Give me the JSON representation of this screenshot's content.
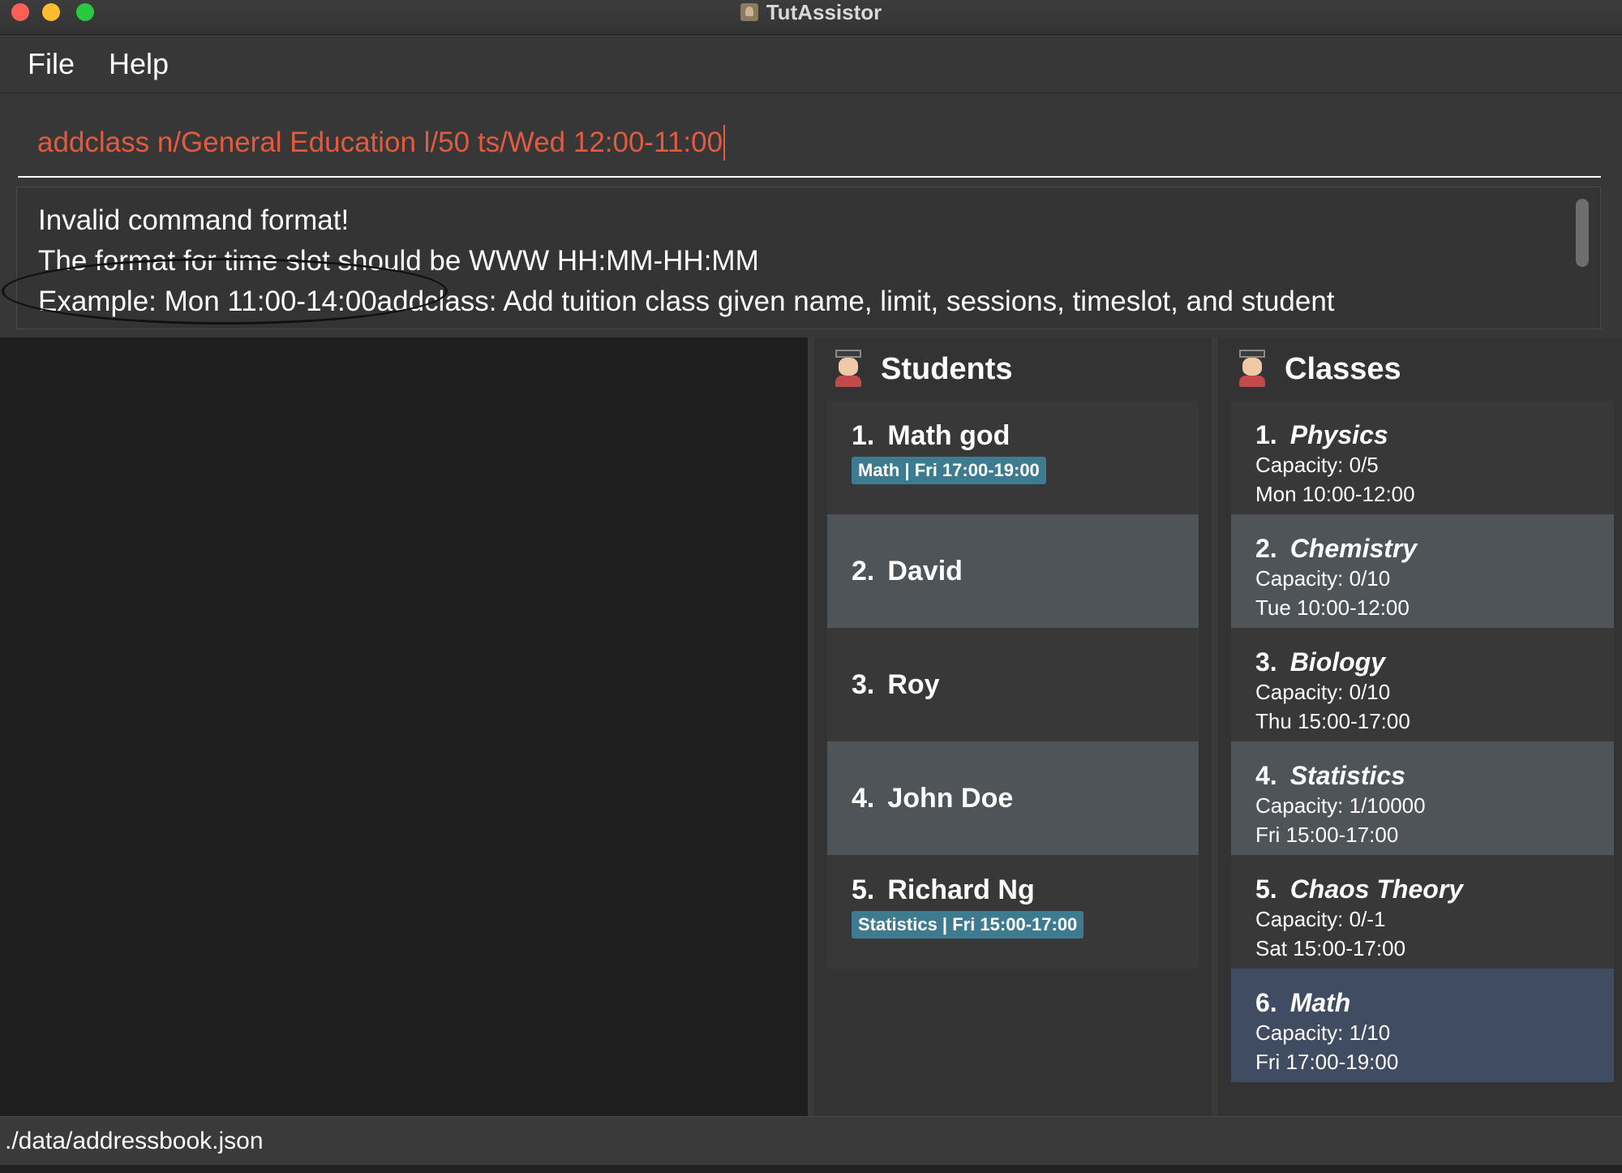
{
  "window": {
    "title": "TutAssistor"
  },
  "menu": {
    "file": "File",
    "help": "Help"
  },
  "command": {
    "value": "addclass n/General Education l/50 ts/Wed 12:00-11:00"
  },
  "result": {
    "lines": [
      "Invalid command format!",
      "The format for time slot should be WWW HH:MM-HH:MM",
      "Example: Mon 11:00-14:00addclass: Add tuition class given name, limit, sessions, timeslot, and student"
    ]
  },
  "students": {
    "title": "Students",
    "icon": "student-avatar-icon",
    "items": [
      {
        "num": "1.",
        "name": "Math god",
        "tag": "Math | Fri 17:00-19:00"
      },
      {
        "num": "2.",
        "name": "David",
        "tag": ""
      },
      {
        "num": "3.",
        "name": "Roy",
        "tag": ""
      },
      {
        "num": "4.",
        "name": "John Doe",
        "tag": ""
      },
      {
        "num": "5.",
        "name": "Richard Ng",
        "tag": "Statistics | Fri 15:00-17:00"
      }
    ]
  },
  "classes": {
    "title": "Classes",
    "icon": "student-avatar-icon",
    "items": [
      {
        "num": "1.",
        "name": "Physics",
        "capacity": "Capacity: 0/5",
        "slot": "Mon 10:00-12:00"
      },
      {
        "num": "2.",
        "name": "Chemistry",
        "capacity": "Capacity: 0/10",
        "slot": "Tue 10:00-12:00"
      },
      {
        "num": "3.",
        "name": "Biology",
        "capacity": "Capacity: 0/10",
        "slot": "Thu 15:00-17:00"
      },
      {
        "num": "4.",
        "name": "Statistics",
        "capacity": "Capacity: 1/10000",
        "slot": "Fri 15:00-17:00"
      },
      {
        "num": "5.",
        "name": "Chaos Theory",
        "capacity": "Capacity: 0/-1",
        "slot": "Sat 15:00-17:00"
      },
      {
        "num": "6.",
        "name": "Math",
        "capacity": "Capacity: 1/10",
        "slot": "Fri 17:00-19:00"
      }
    ]
  },
  "status": {
    "path": "./data/addressbook.json"
  },
  "colors": {
    "command_text": "#e35b3f",
    "tag_bg": "#3e7b91",
    "selected_card": "#3f4c61"
  }
}
